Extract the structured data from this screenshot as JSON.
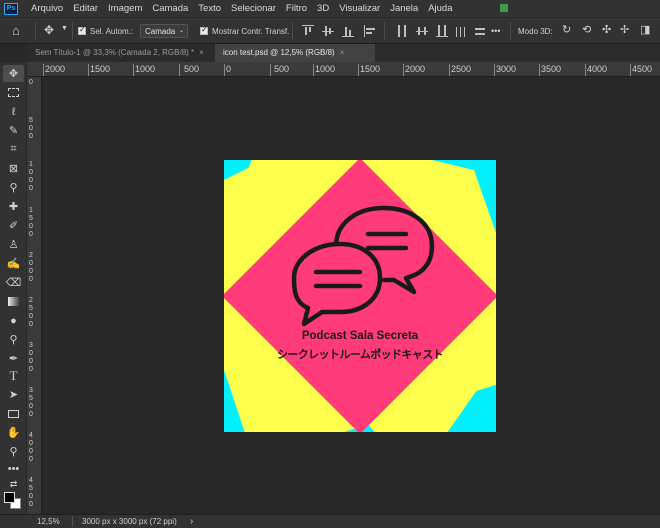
{
  "app": {
    "logo": "Ps"
  },
  "menu": [
    "Arquivo",
    "Editar",
    "Imagem",
    "Camada",
    "Texto",
    "Selecionar",
    "Filtro",
    "3D",
    "Visualizar",
    "Janela",
    "Ajuda"
  ],
  "options": {
    "auto_select_label": "Sel. Autom.:",
    "auto_select_value": "Camada",
    "show_transform_label": "Mostrar Contr. Transf.",
    "more": "•••",
    "mode_3d_label": "Modo 3D:"
  },
  "tabs": [
    {
      "label": "Sem Título-1 @ 33,3% (Camada 2, RGB/8) *",
      "close": "×"
    },
    {
      "label": "icon test.psd @ 12,5% (RGB/8)",
      "close": "×"
    }
  ],
  "ruler_h": [
    "2000",
    "1500",
    "1000",
    "500",
    "0",
    "500",
    "1000",
    "1500",
    "2000",
    "2500",
    "3000",
    "3500",
    "4000",
    "4500"
  ],
  "ruler_v": [
    "0",
    "5 0 0",
    "1 0 0 0",
    "1 5 0 0",
    "2 0 0 0",
    "2 5 0 0",
    "3 0 0 0",
    "3 5 0 0",
    "4 0 0 0",
    "4 5 0 0"
  ],
  "artwork": {
    "title": "Podcast Sala Secreta",
    "subtitle": "シークレットルームポッドキャスト",
    "colors": {
      "cyan": "#00f0ff",
      "yellow": "#ffff4d",
      "pink": "#ff3b79",
      "ink": "#1a1a1a"
    }
  },
  "status": {
    "zoom": "12,5%",
    "doc_info": "3000 px x 3000 px (72 ppi)",
    "arrow": "›"
  },
  "icons": {
    "home": "⌂",
    "move": "✥",
    "more_tools": "•••"
  }
}
